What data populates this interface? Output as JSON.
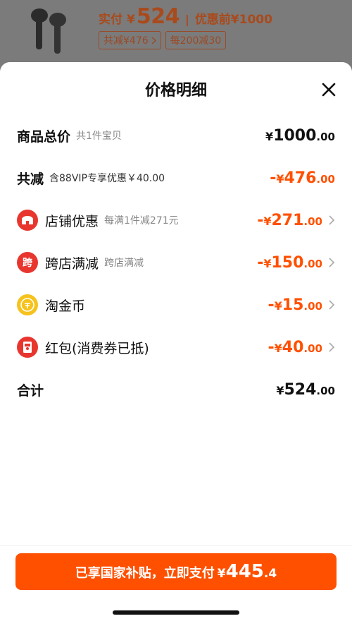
{
  "product": {
    "pay_label": "实付",
    "currency": "¥",
    "price": "524",
    "separator": "|",
    "before_label": "优惠前¥1000",
    "tags": [
      {
        "label": "共减¥476",
        "has_chevron": true
      },
      {
        "label": "每200减30",
        "has_chevron": false
      }
    ]
  },
  "sheet": {
    "title": "价格明细",
    "rows": [
      {
        "main": "商品总价",
        "sub": "共1件宝贝",
        "yen": "¥",
        "int": "1000",
        "dec": ".00",
        "sign": "",
        "color": "black",
        "icon": "",
        "chevron": false
      },
      {
        "main": "共减",
        "sub": "含88VIP专享优惠￥40.00",
        "yen": "¥",
        "int": "476",
        "dec": ".00",
        "sign": "-",
        "color": "orange",
        "icon": "",
        "chevron": false
      },
      {
        "main": "店铺优惠",
        "sub": "每满1件减271元",
        "yen": "¥",
        "int": "271",
        "dec": ".00",
        "sign": "-",
        "color": "orange",
        "icon": "shop-icon",
        "chevron": true
      },
      {
        "main": "跨店满减",
        "sub": "跨店满减",
        "yen": "¥",
        "int": "150",
        "dec": ".00",
        "sign": "-",
        "color": "orange",
        "icon": "cross-store-icon",
        "chevron": true
      },
      {
        "main": "淘金币",
        "sub": "",
        "yen": "¥",
        "int": "15",
        "dec": ".00",
        "sign": "-",
        "color": "orange",
        "icon": "coin-icon",
        "chevron": true
      },
      {
        "main": "红包(消费券已抵)",
        "sub": "",
        "yen": "¥",
        "int": "40",
        "dec": ".00",
        "sign": "-",
        "color": "orange",
        "icon": "red-packet-icon",
        "chevron": true
      },
      {
        "main": "合计",
        "sub": "",
        "yen": "¥",
        "int": "524",
        "dec": ".00",
        "sign": "",
        "color": "black",
        "icon": "",
        "chevron": false
      }
    ],
    "cross_store_glyph": "跨"
  },
  "cta": {
    "text": "已享国家补贴，立即支付",
    "yen": "¥",
    "int": "445",
    "dec": ".4"
  },
  "colors": {
    "accent": "#ff5000",
    "shop_icon_bg": "#e8362f",
    "cross_icon_bg": "#e8362f",
    "coin_bg": "#f6c21c",
    "packet_bg": "#e8362f"
  }
}
